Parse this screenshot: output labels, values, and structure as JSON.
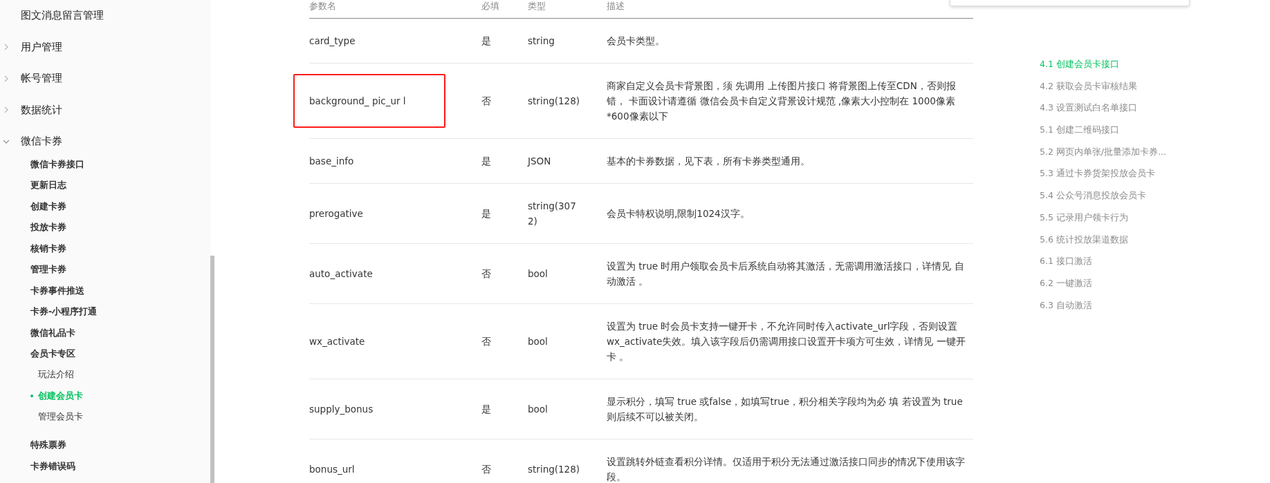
{
  "sidebar": {
    "items": [
      {
        "label": "图文消息留言管理"
      },
      {
        "label": "用户管理",
        "expanded": false
      },
      {
        "label": "帐号管理",
        "expanded": false
      },
      {
        "label": "数据统计",
        "expanded": false
      },
      {
        "label": "微信卡券",
        "expanded": true,
        "children": [
          {
            "label": "微信卡券接口"
          },
          {
            "label": "更新日志"
          },
          {
            "label": "创建卡券"
          },
          {
            "label": "投放卡券"
          },
          {
            "label": "核销卡券"
          },
          {
            "label": "管理卡券"
          },
          {
            "label": "卡券事件推送"
          },
          {
            "label": "卡券-小程序打通"
          },
          {
            "label": "微信礼品卡"
          },
          {
            "label": "会员卡专区",
            "children": [
              {
                "label": "玩法介绍",
                "selected": false
              },
              {
                "label": "创建会员卡",
                "selected": true
              },
              {
                "label": "管理会员卡",
                "selected": false
              }
            ]
          },
          {
            "label": "特殊票券"
          },
          {
            "label": "卡券错误码"
          }
        ]
      }
    ]
  },
  "table": {
    "columns": [
      "参数名",
      "必填",
      "类型",
      "描述"
    ],
    "rows": [
      {
        "name": "card_type",
        "required": "是",
        "type": "string",
        "description": "会员卡类型。",
        "highlighted": false
      },
      {
        "name": "background_ pic_ur l",
        "required": "否",
        "type": "string(128)",
        "description": "商家自定义会员卡背景图，须 先调用 上传图片接口 将背景图上传至CDN，否则报错， 卡面设计请遵循 微信会员卡自定义背景设计规范 ,像素大小控制在 1000像素*600像素以下",
        "highlighted": true
      },
      {
        "name": "base_info",
        "required": "是",
        "type": "JSON",
        "description": "基本的卡券数据，见下表，所有卡券类型通用。",
        "highlighted": false
      },
      {
        "name": "prerogative",
        "required": "是",
        "type": "string(3072)",
        "description": "会员卡特权说明,限制1024汉字。",
        "highlighted": false
      },
      {
        "name": "auto_activate",
        "required": "否",
        "type": "bool",
        "description": "设置为 true 时用户领取会员卡后系统自动将其激活，无需调用激活接口，详情见 自动激活 。",
        "highlighted": false
      },
      {
        "name": "wx_activate",
        "required": "否",
        "type": "bool",
        "description": "设置为 true 时会员卡支持一键开卡，不允许同时传入activate_url字段，否则设置wx_activate失效。填入该字段后仍需调用接口设置开卡项方可生效，详情见 一键开卡 。",
        "highlighted": false
      },
      {
        "name": "supply_bonus",
        "required": "是",
        "type": "bool",
        "description": "显示积分，填写 true 或false，如填写true，积分相关字段均为必 填 若设置为 true 则后续不可以被关闭。",
        "highlighted": false
      },
      {
        "name": "bonus_url",
        "required": "否",
        "type": "string(128)",
        "description": "设置跳转外链查看积分详情。仅适用于积分无法通过激活接口同步的情况下使用该字段。",
        "highlighted": false
      }
    ]
  },
  "toc": [
    {
      "label": "4.1 创建会员卡接口",
      "selected": true
    },
    {
      "label": "4.2 获取会员卡审核结果",
      "selected": false
    },
    {
      "label": "4.3 设置测试白名单接口",
      "selected": false
    },
    {
      "label": "5.1 创建二维码接口",
      "selected": false
    },
    {
      "label": "5.2 网页内单张/批量添加卡券...",
      "selected": false
    },
    {
      "label": "5.3 通过卡券货架投放会员卡",
      "selected": false
    },
    {
      "label": "5.4 公众号消息投放会员卡",
      "selected": false
    },
    {
      "label": "5.5 记录用户领卡行为",
      "selected": false
    },
    {
      "label": "5.6 统计投放渠道数据",
      "selected": false
    },
    {
      "label": "6.1 接口激活",
      "selected": false
    },
    {
      "label": "6.2 一键激活",
      "selected": false
    },
    {
      "label": "6.3 自动激活",
      "selected": false
    }
  ]
}
